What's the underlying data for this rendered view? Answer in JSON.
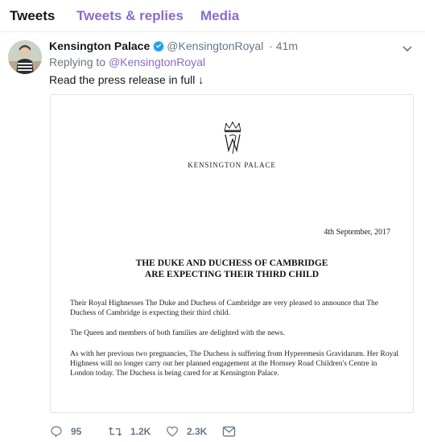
{
  "tabs": {
    "tweets": "Tweets",
    "replies": "Tweets & replies",
    "media": "Media"
  },
  "tweet": {
    "author_name": "Kensington Palace",
    "handle": "@KensingtonRoyal",
    "time": "· 41m",
    "replying_prefix": "Replying to",
    "replying_to": "@KensingtonRoyal",
    "text": "Read the press release in full ↓"
  },
  "document": {
    "palace_name": "KENSINGTON PALACE",
    "date": "4th September, 2017",
    "headline_line1": "THE DUKE AND DUCHESS OF CAMBRIDGE",
    "headline_line2": "ARE EXPECTING THEIR THIRD CHILD",
    "paragraph1": "Their Royal Highnesses The Duke and Duchess of Cambridge are very pleased to announce that The Duchess of Cambridge is expecting their third child.",
    "paragraph2": "The Queen and members of both families are delighted with the news.",
    "paragraph3": "As with her previous two pregnancies, The Duchess is suffering from Hyperemesis Gravidarum. Her Royal Highness will no longer carry out her planned engagement at the Hornsey Road Children's Centre in London today. The Duchess is being cared for at Kensington Palace."
  },
  "actions": {
    "replies": "95",
    "retweets": "1.2K",
    "likes": "2.3K"
  },
  "icons": {
    "verified": "verified-badge-icon",
    "chevron": "chevron-down-icon",
    "reply": "reply-icon",
    "retweet": "retweet-icon",
    "like": "heart-icon",
    "dm": "envelope-icon",
    "cypher": "royal-cypher-icon"
  },
  "colors": {
    "accent": "#8a6cc4",
    "verified": "#1da1f2",
    "muted": "#657786",
    "text": "#14171a"
  }
}
